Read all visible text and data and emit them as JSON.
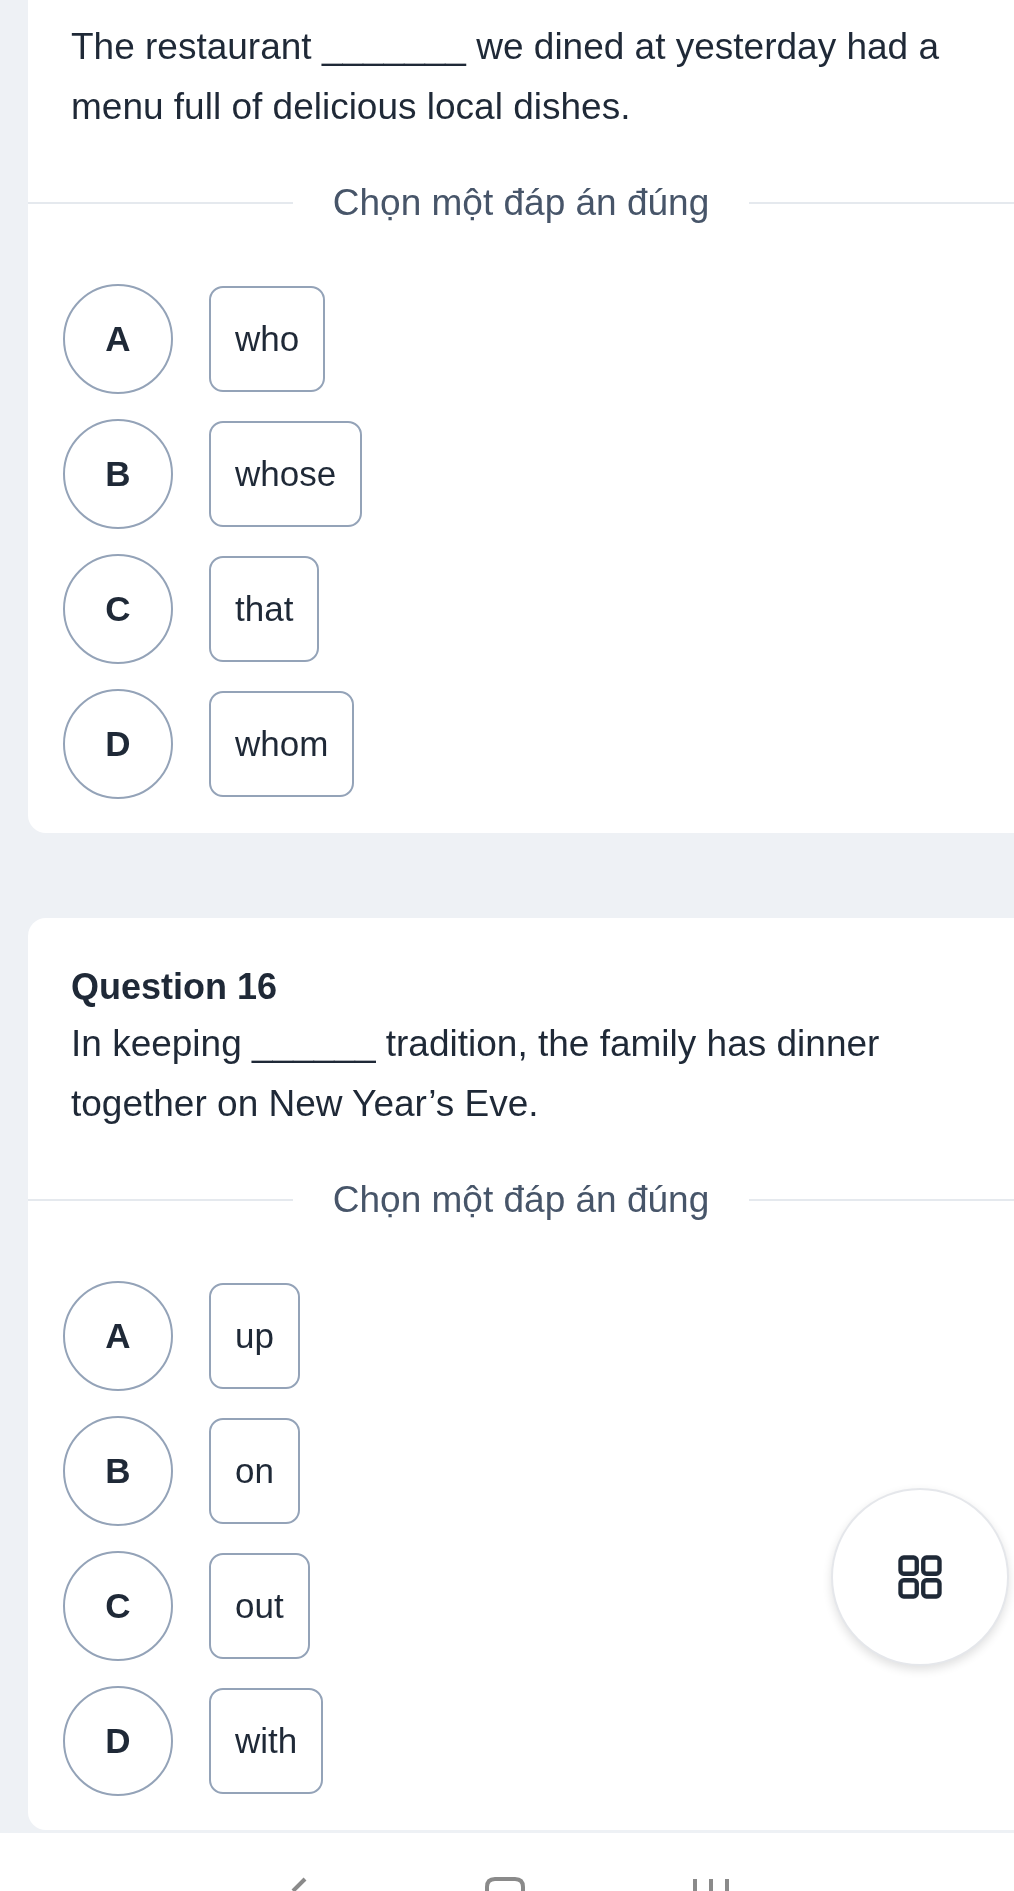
{
  "questions": [
    {
      "text": "The restaurant _______ we dined at yesterday had a menu full of delicious local dishes.",
      "prompt": "Chọn một đáp án đúng",
      "options": [
        {
          "letter": "A",
          "answer": "who",
          "selected": false
        },
        {
          "letter": "B",
          "answer": "whose",
          "selected": false
        },
        {
          "letter": "C",
          "answer": "that",
          "selected": false
        },
        {
          "letter": "D",
          "answer": "whom",
          "selected": false
        }
      ]
    },
    {
      "title": "Question 16",
      "text": "In keeping ______ tradition, the family has dinner together on New Year’s Eve.",
      "prompt": "Chọn một đáp án đúng",
      "options": [
        {
          "letter": "A",
          "answer": "up",
          "selected": false
        },
        {
          "letter": "B",
          "answer": "on",
          "selected": false
        },
        {
          "letter": "C",
          "answer": "out",
          "selected": false
        },
        {
          "letter": "D",
          "answer": "with",
          "selected": false
        }
      ]
    }
  ]
}
